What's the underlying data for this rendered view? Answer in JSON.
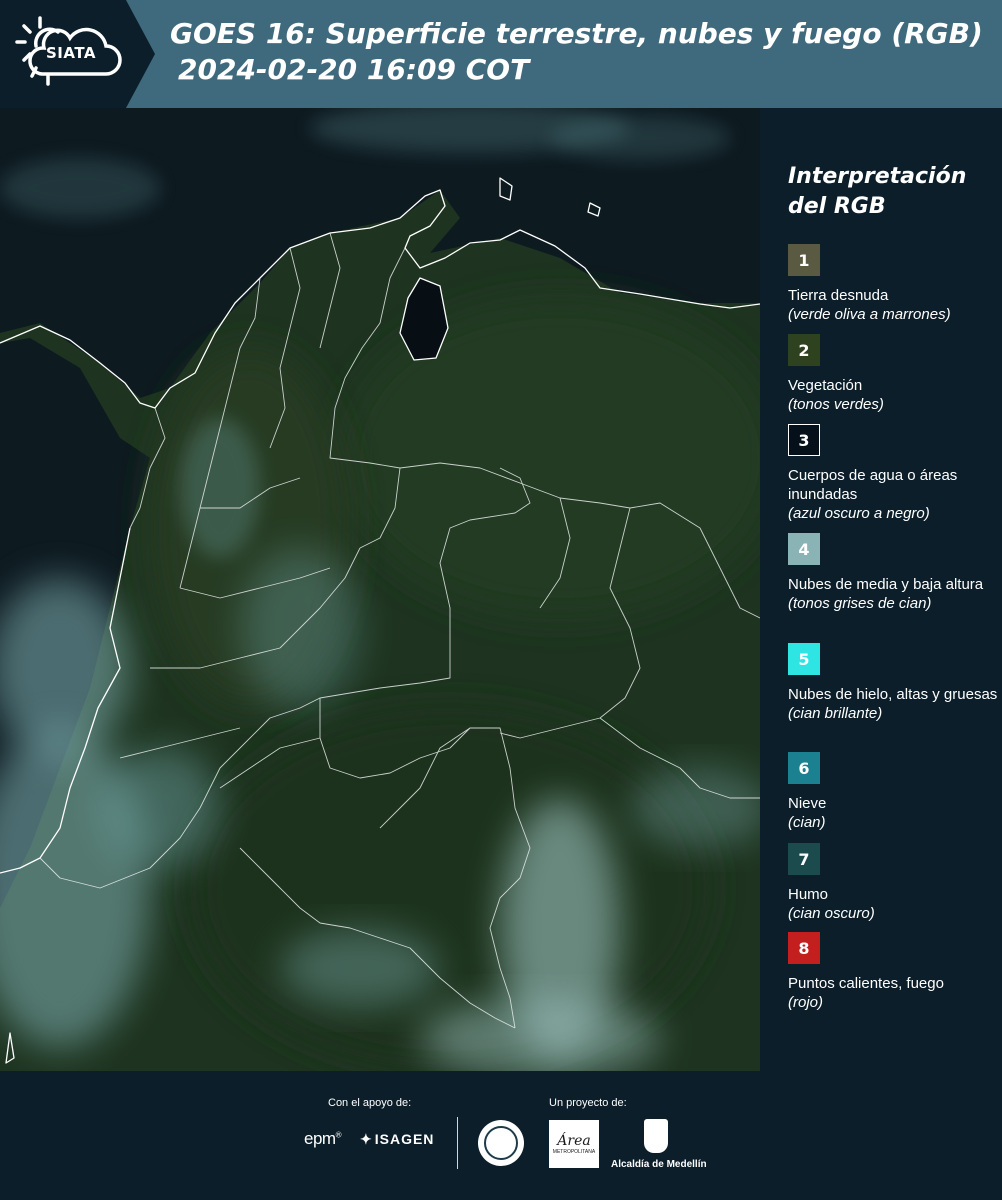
{
  "header": {
    "logo_text": "SIATA",
    "title": "GOES 16: Superficie terrestre, nubes y fuego (RGB)",
    "datetime": "2024-02-20 16:09 COT"
  },
  "map": {
    "image_name": "goes16-rgb-colombia-map"
  },
  "legend": {
    "heading_line1": "Interpretación",
    "heading_line2": "del RGB",
    "items": [
      {
        "number": "1",
        "color": "#5a5a42",
        "label": "Tierra desnuda",
        "desc": "(verde oliva a marrones)"
      },
      {
        "number": "2",
        "color": "#2f4220",
        "label": "Vegetación",
        "desc": "(tonos verdes)"
      },
      {
        "number": "3",
        "color": "#06101a",
        "label": "Cuerpos de agua o áreas inundadas",
        "desc": "(azul oscuro a negro)"
      },
      {
        "number": "4",
        "color": "#89b3b4",
        "label": "Nubes de media y baja altura",
        "desc": "(tonos grises de cian)"
      },
      {
        "number": "5",
        "color": "#2ee5e3",
        "label": "Nubes de hielo, altas y gruesas",
        "desc": "(cian brillante)"
      },
      {
        "number": "6",
        "color": "#1b8090",
        "label": "Nieve",
        "desc": "(cian)"
      },
      {
        "number": "7",
        "color": "#1b4b4d",
        "label": "Humo",
        "desc": "(cian oscuro)"
      },
      {
        "number": "8",
        "color": "#c41f1f",
        "label": "Puntos calientes, fuego",
        "desc": "(rojo)"
      }
    ]
  },
  "footer": {
    "support_label": "Con el apoyo de:",
    "project_label": "Un proyecto de:",
    "epm": "epm",
    "epm_mark": "®",
    "isagen": "ISAGEN",
    "area_word": "Área",
    "area_sub": "METROPOLITANA",
    "medellin": "Alcaldía de Medellín"
  }
}
